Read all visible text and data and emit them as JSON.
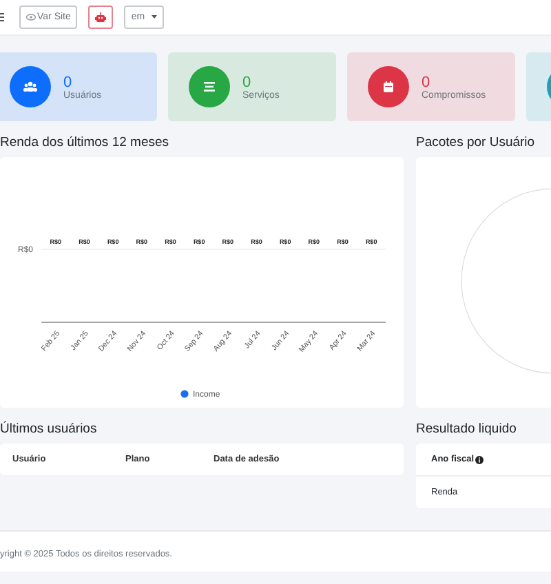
{
  "topbar": {
    "view_site": "Var Site",
    "language": "em"
  },
  "stats": [
    {
      "value": "0",
      "label": "Usuários",
      "color": "#0d6efd",
      "kind": "users"
    },
    {
      "value": "0",
      "label": "Serviços",
      "color": "#28a745",
      "kind": "list"
    },
    {
      "value": "0",
      "label": "Compromissos",
      "color": "#dc3545",
      "kind": "calendar"
    },
    {
      "color": "#17a2b8",
      "kind": "other"
    }
  ],
  "income_panel": {
    "title": "Renda dos últimos 12 meses",
    "x_labels": [
      "Feb 25",
      "Jan 25",
      "Dec 24",
      "Nov 24",
      "Oct 24",
      "Sep 24",
      "Aug 24",
      "Jul 24",
      "Jun 24",
      "May 24",
      "Apr 24",
      "Mar 24"
    ],
    "legend": {
      "name": "Income",
      "color": "#1a6ff0"
    },
    "value_labels": [
      "R$0",
      "R$0",
      "R$0",
      "R$0",
      "R$0",
      "R$0",
      "R$0",
      "R$0",
      "R$0",
      "R$0",
      "R$0",
      "R$0"
    ],
    "y_axis_label": "R$0"
  },
  "packages_panel": {
    "title": "Pacotes por Usuário"
  },
  "latest_users": {
    "title": "Últimos usuários",
    "columns": [
      "Usuário",
      "Plano",
      "Data de adesão"
    ]
  },
  "net_result": {
    "title": "Resultado liquido",
    "rows": [
      {
        "label": "Ano fiscal",
        "info": true
      },
      {
        "label": "Renda",
        "info": false
      }
    ]
  },
  "footer": {
    "text": "yright © 2025 Todos os direitos reservados."
  }
}
